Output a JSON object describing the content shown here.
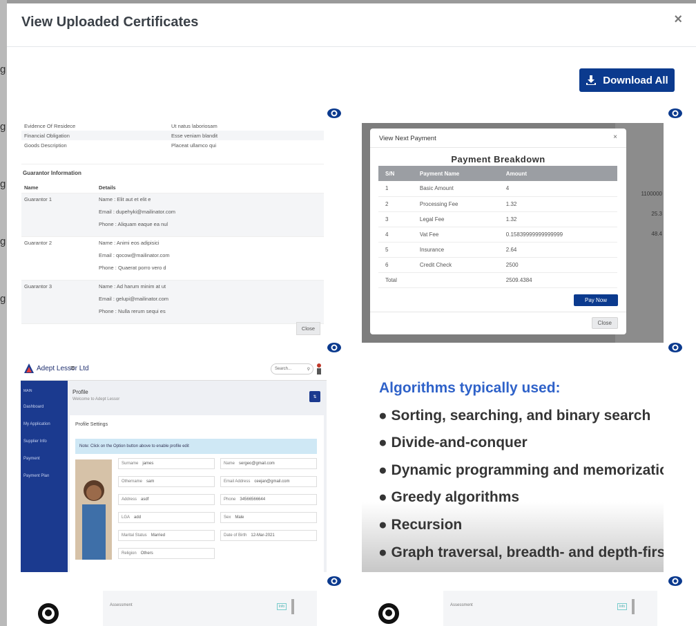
{
  "modal": {
    "title": "View Uploaded Certificates",
    "close_glyph": "×",
    "download_all_label": "Download All"
  },
  "backdrop": {
    "letters": [
      "g",
      "g",
      "g",
      "g",
      "g"
    ]
  },
  "icons": {
    "eye": "eye-icon",
    "download": "download-icon"
  },
  "colors": {
    "primary": "#0b3a8e",
    "slide_title": "#2f62c9"
  },
  "thumb1": {
    "rows": [
      {
        "k": "Evidence Of Residece",
        "v": "Ut natus laboriosam"
      },
      {
        "k": "Financial Obligation",
        "v": "Esse veniam blandit"
      },
      {
        "k": "Goods Description",
        "v": "Placeat ullamco qui"
      }
    ],
    "section": "Guarantor Information",
    "head_name": "Name",
    "head_details": "Details",
    "guarantors": [
      {
        "k": "Guarantor 1",
        "name": "Name : Elit aut et elit e",
        "email": "Email : dupehyki@mailinator.com",
        "phone": "Phone : Aliquam eaque ea nul"
      },
      {
        "k": "Guarantor 2",
        "name": "Name : Animi eos adipisici",
        "email": "Email : qocow@mailinator.com",
        "phone": "Phone : Quaerat porro vero d"
      },
      {
        "k": "Guarantor 3",
        "name": "Name : Ad harum minim at ut",
        "email": "Email : gelupi@mailinator.com",
        "phone": "Phone : Nulla rerum sequi es"
      }
    ],
    "close": "Close"
  },
  "thumb2": {
    "under": [
      "1100000",
      "25.3",
      "48.4"
    ],
    "title": "View Next Payment",
    "x": "×",
    "breakdown_title": "Payment Breakdown",
    "headers": [
      "S/N",
      "Payment Name",
      "Amount"
    ],
    "rows": [
      [
        "1",
        "Basic Amount",
        "4"
      ],
      [
        "2",
        "Processing Fee",
        "1.32"
      ],
      [
        "3",
        "Legal Fee",
        "1.32"
      ],
      [
        "4",
        "Vat Fee",
        "0.15839999999999999"
      ],
      [
        "5",
        "Insurance",
        "2.64"
      ],
      [
        "6",
        "Credit Check",
        "2500"
      ]
    ],
    "total_label": "Total",
    "total": "2509.4384",
    "pay_now": "Pay Now",
    "close": "Close"
  },
  "thumb3": {
    "brand": "Adept Lessor Ltd",
    "search": "Search...",
    "side_label": "MAIN",
    "side_items": [
      "Dashboard",
      "My Application",
      "Supplier Info",
      "Payment",
      "Payment Plan"
    ],
    "page_title": "Profile",
    "page_sub": "Welcome to Adept Lessor",
    "settings": "Profile Settings",
    "note": "Note: Click on the Option button above to enable profile edit",
    "fields": [
      {
        "l": "Surname",
        "v": "james"
      },
      {
        "l": "Name",
        "v": "sergeo@gmail.com"
      },
      {
        "l": "Othername",
        "v": "sam"
      },
      {
        "l": "Email Address",
        "v": "ceejan@gmail.com"
      },
      {
        "l": "Address",
        "v": "asdf"
      },
      {
        "l": "Phone",
        "v": "34566566644"
      },
      {
        "l": "LGA",
        "v": "add"
      },
      {
        "l": "Sex",
        "v": "Male"
      },
      {
        "l": "Marital Status",
        "v": "Married"
      },
      {
        "l": "Date of Birth",
        "v": "12-Mar-2021"
      },
      {
        "l": "Religion",
        "v": "Others"
      }
    ]
  },
  "thumb4": {
    "title": "Algorithms typically used:",
    "bullets": [
      "Sorting, searching, and binary search",
      "Divide-and-conquer",
      "Dynamic programming and memorization",
      "Greedy algorithms",
      "Recursion",
      "Graph traversal, breadth- and depth-first"
    ]
  },
  "thumb5": {
    "label": "Assessment",
    "tag": "Info"
  },
  "thumb6": {
    "label": "Assessment",
    "tag": "Info"
  }
}
